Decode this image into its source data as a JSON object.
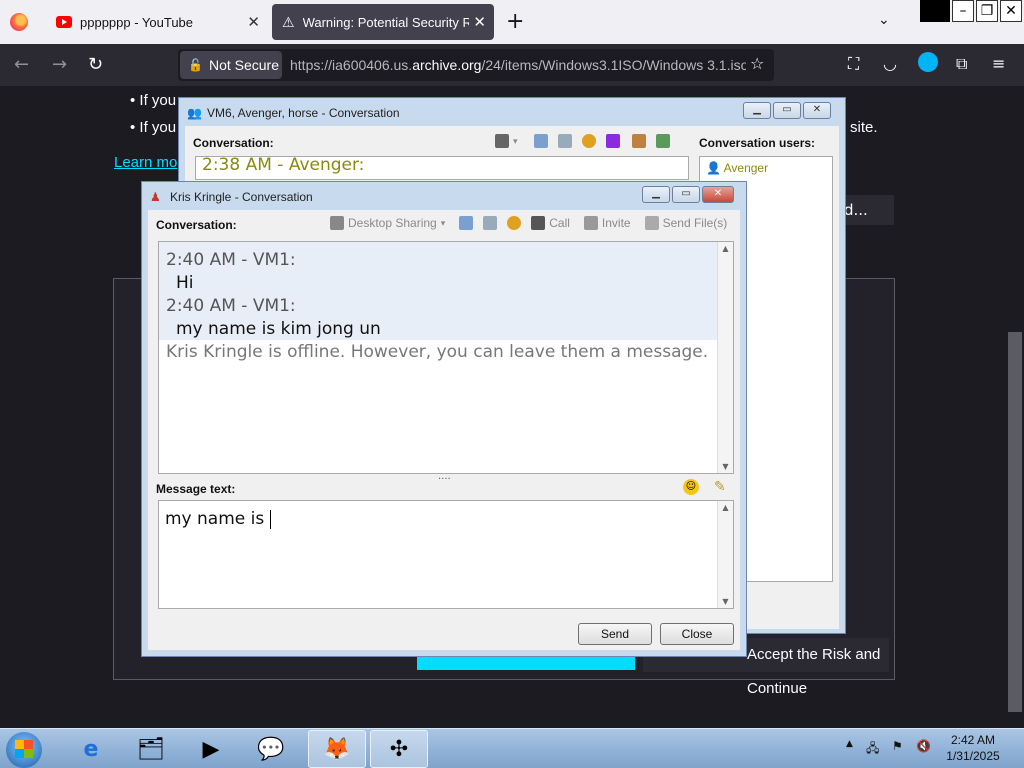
{
  "browser": {
    "tabs": [
      {
        "title": "ppppppp - YouTube",
        "active": false
      },
      {
        "title": "Warning: Potential Security Risk",
        "active": true
      }
    ],
    "security_label": "Not Secure",
    "url_prefix": "https://ia600406.us.",
    "url_domain": "archive.org",
    "url_path": "/24/items/Windows3.1ISO/Windows 3.1.iso"
  },
  "page": {
    "bullet1": "If you",
    "bullet2": "If you",
    "bullet2_end": "site.",
    "learn_more": "Learn mo",
    "advanced_label": "d...",
    "accept_label": "Accept the Risk and Continue"
  },
  "back_window": {
    "title": "VM6, Avenger, horse - Conversation",
    "conversation_label": "Conversation:",
    "last_message": "2:38 AM - Avenger:",
    "users_label": "Conversation users:",
    "users": [
      "Avenger"
    ]
  },
  "front_window": {
    "title": "Kris Kringle - Conversation",
    "conversation_label": "Conversation:",
    "toolbar": {
      "desktop_sharing": "Desktop Sharing",
      "call": "Call",
      "invite": "Invite",
      "send_files": "Send File(s)"
    },
    "messages": [
      {
        "timestamp": "2:40 AM - VM1:",
        "text": "Hi"
      },
      {
        "timestamp": "2:40 AM - VM1:",
        "text": "my name is kim jong un"
      }
    ],
    "status": "Kris Kringle is offline. However, you can leave them a message.",
    "message_text_label": "Message text:",
    "draft": "my name is ",
    "send_label": "Send",
    "close_label": "Close"
  },
  "taskbar": {
    "time": "2:42 AM",
    "date": "1/31/2025"
  },
  "colors": {
    "firefox_dark_bg": "#1c1b22",
    "link_cyan": "#00ddff",
    "chat_selected": "#e8eef7",
    "avenger_olive": "#8a8a10"
  }
}
